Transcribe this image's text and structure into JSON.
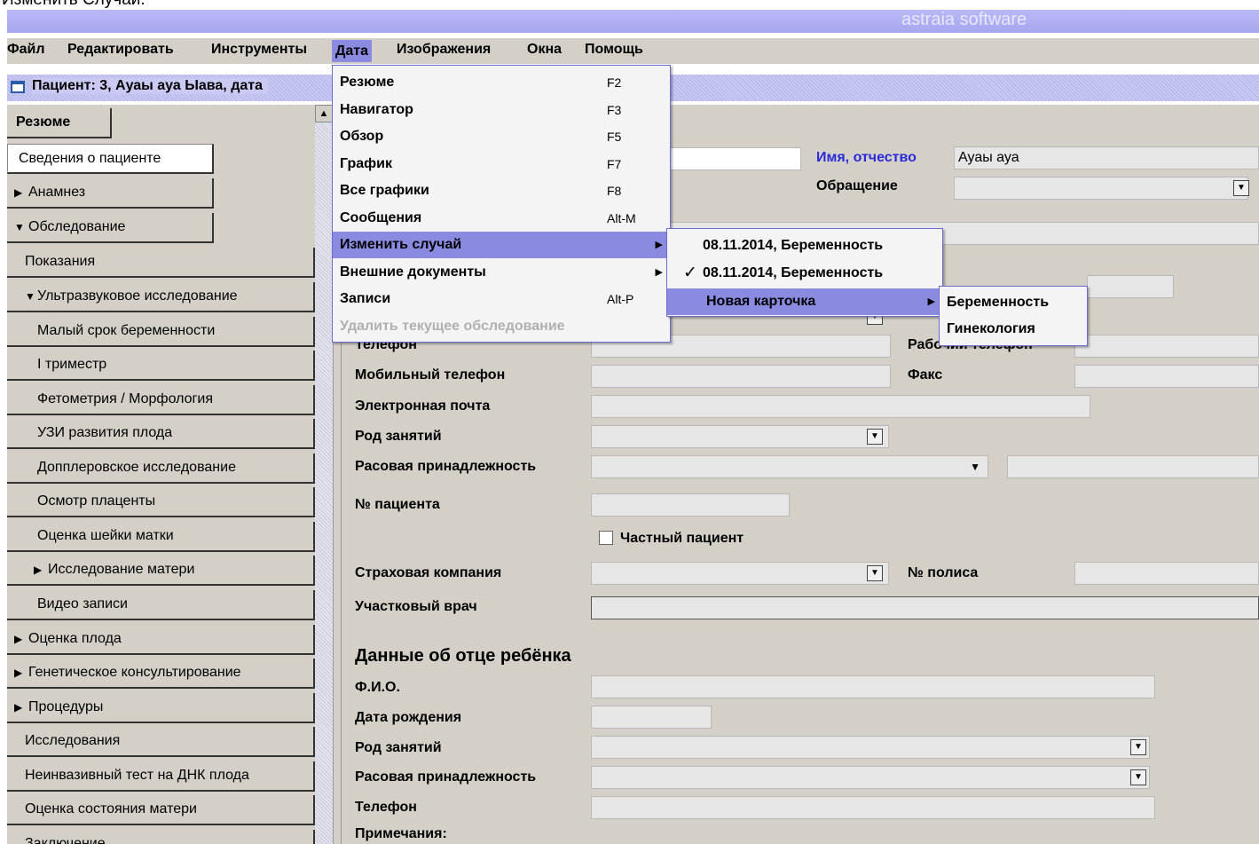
{
  "caption": "Изменить Случай.",
  "app_title": "astraia software",
  "menubar": [
    "Файл",
    "Редактировать",
    "Инструменты",
    "Дата",
    "Изображения",
    "Окна",
    "Помощь"
  ],
  "window_title": "Пациент: 3, Ауаы ауа Ыава, дата",
  "sidebar": {
    "tab": "Резюме",
    "items": [
      {
        "label": "Сведения о пациенте",
        "arrow": ""
      },
      {
        "label": "Анамнез",
        "arrow": "▶"
      },
      {
        "label": "Обследование",
        "arrow": "▼"
      },
      {
        "label": "Показания",
        "arrow": ""
      },
      {
        "label": "Ультразвуковое исследование",
        "arrow": "▼"
      },
      {
        "label": "Малый срок беременности",
        "arrow": ""
      },
      {
        "label": "I триместр",
        "arrow": ""
      },
      {
        "label": "Фетометрия / Морфология",
        "arrow": ""
      },
      {
        "label": "УЗИ развития плода",
        "arrow": ""
      },
      {
        "label": "Допплеровское исследование",
        "arrow": ""
      },
      {
        "label": "Осмотр плаценты",
        "arrow": ""
      },
      {
        "label": "Оценка шейки матки",
        "arrow": ""
      },
      {
        "label": "Исследование матери",
        "arrow": "▶"
      },
      {
        "label": "Видео записи",
        "arrow": ""
      },
      {
        "label": "Оценка плода",
        "arrow": "▶"
      },
      {
        "label": "Генетическое консультирование",
        "arrow": "▶"
      },
      {
        "label": "Процедуры",
        "arrow": "▶"
      },
      {
        "label": "Исследования",
        "arrow": ""
      },
      {
        "label": "Неинвазивный тест на ДНК плода",
        "arrow": ""
      },
      {
        "label": "Оценка состояния матери",
        "arrow": ""
      },
      {
        "label": "Заключение",
        "arrow": ""
      }
    ]
  },
  "form": {
    "name_label": "Имя, отчество",
    "name_value": "Ауаы ауа",
    "salutation_label": "Обращение",
    "phone": "Телефон",
    "work_phone": "Рабочий телефон",
    "mobile": "Мобильный телефон",
    "fax": "Факс",
    "email": "Электронная почта",
    "occupation": "Род занятий",
    "race": "Расовая принадлежность",
    "patient_no": "№ пациента",
    "private_patient": "Частный пациент",
    "insurance": "Страховая компания",
    "policy_no": "№ полиса",
    "district_doctor": "Участковый врач",
    "father_header": "Данные об отце ребёнка",
    "father_name": "Ф.И.О.",
    "father_dob": "Дата рождения",
    "father_occupation": "Род занятий",
    "father_race": "Расовая принадлежность",
    "father_phone": "Телефон",
    "notes": "Примечания:"
  },
  "data_menu": [
    {
      "label": "Резюме",
      "shortcut": "F2"
    },
    {
      "label": "Навигатор",
      "shortcut": "F3"
    },
    {
      "label": "Обзор",
      "shortcut": "F5"
    },
    {
      "label": "График",
      "shortcut": "F7"
    },
    {
      "label": "Все графики",
      "shortcut": "F8"
    },
    {
      "label": "Сообщения",
      "shortcut": "Alt-M"
    },
    {
      "label": "Изменить случай",
      "shortcut": ""
    },
    {
      "label": "Внешние документы",
      "shortcut": ""
    },
    {
      "label": "Записи",
      "shortcut": "Alt-P"
    },
    {
      "label": "Удалить текущее обследование",
      "shortcut": ""
    }
  ],
  "case_submenu": [
    {
      "label": "08.11.2014, Беременность",
      "check": ""
    },
    {
      "label": "08.11.2014, Беременность",
      "check": "✓"
    },
    {
      "label": "Новая карточка",
      "check": ""
    }
  ],
  "new_card_submenu": [
    "Беременность",
    "Гинекология"
  ]
}
